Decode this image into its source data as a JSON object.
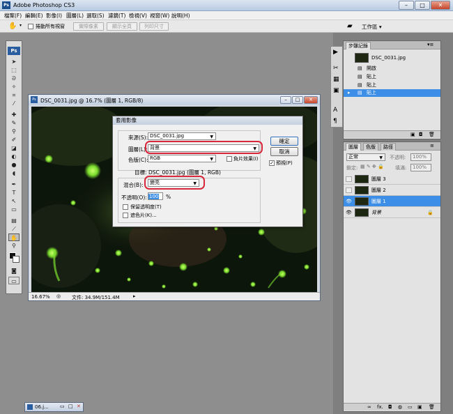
{
  "window": {
    "title": "Adobe Photoshop CS3",
    "min": "–",
    "max": "□",
    "close": "✕"
  },
  "menu": [
    "檔案(F)",
    "編輯(E)",
    "影像(I)",
    "圖層(L)",
    "選取(S)",
    "濾鏡(T)",
    "檢視(V)",
    "視窗(W)",
    "說明(H)"
  ],
  "options": {
    "scroll_all_label": "捲動所有視窗",
    "actual_pixels": "實際像素",
    "fit_screen": "顯示全頁",
    "print_size": "列印尺寸",
    "workspace": "工作區 ▾"
  },
  "toolbox": {
    "logo": "Ps",
    "tools": [
      "▸✥",
      "⬚",
      "ᑕ",
      "✎",
      "⌗",
      "✂",
      "✚",
      "✐",
      "⚘",
      "▞",
      "◐",
      "◖",
      "●",
      "✍",
      "⬭",
      "T",
      "↖",
      "▭",
      "☟",
      "🔍"
    ]
  },
  "document": {
    "title": "DSC_0031.jpg @ 16.7% (圖層 1, RGB/8)",
    "zoom": "16.67%",
    "status": "文件: 34.9M/151.4M"
  },
  "dialog": {
    "title": "套用影像",
    "source_label": "來源(S):",
    "source_value": "DSC_0031.jpg",
    "layer_label": "圖層(L):",
    "layer_value": "背景",
    "channel_label": "色版(C):",
    "channel_value": "RGB",
    "invert_label": "負片效果(I)",
    "target_label": "目標:",
    "target_value": "DSC_0031.jpg (圖層 1, RGB)",
    "blending_label": "混合(B):",
    "blending_value": "變亮",
    "opacity_label": "不透明(O):",
    "opacity_value": "100",
    "opacity_unit": "%",
    "preserve_label": "保留透明度(T)",
    "mask_label": "遮色片(K)...",
    "ok": "確定",
    "cancel": "取消",
    "preview_label": "預視(P)",
    "preview_checked": "✓"
  },
  "history": {
    "tabs": [
      "步驟記錄"
    ],
    "snapshot": "DSC_0031.jpg",
    "items": [
      "開啟",
      "貼上",
      "貼上",
      "貼上"
    ]
  },
  "layers": {
    "tabs": [
      "圖層",
      "色版",
      "路徑"
    ],
    "blend_mode": "正常",
    "opacity_label": "不透明:",
    "opacity_value": "100%",
    "lock_label": "鎖定:",
    "fill_label": "填滿:",
    "fill_value": "100%",
    "items": [
      {
        "name": "圖層 3",
        "visible": false
      },
      {
        "name": "圖層 2",
        "visible": false
      },
      {
        "name": "圖層 1",
        "visible": true
      },
      {
        "name": "背景",
        "visible": true
      }
    ],
    "footer_icons": [
      "∞",
      "fx.",
      "◘",
      "◍",
      "▭",
      "▣",
      "🗑"
    ]
  },
  "mini_doc": {
    "title": "06.j..."
  },
  "colors": {
    "selection": "#3d8ee6",
    "highlight": "#d8263a",
    "firefly": "#7cdc2e"
  }
}
